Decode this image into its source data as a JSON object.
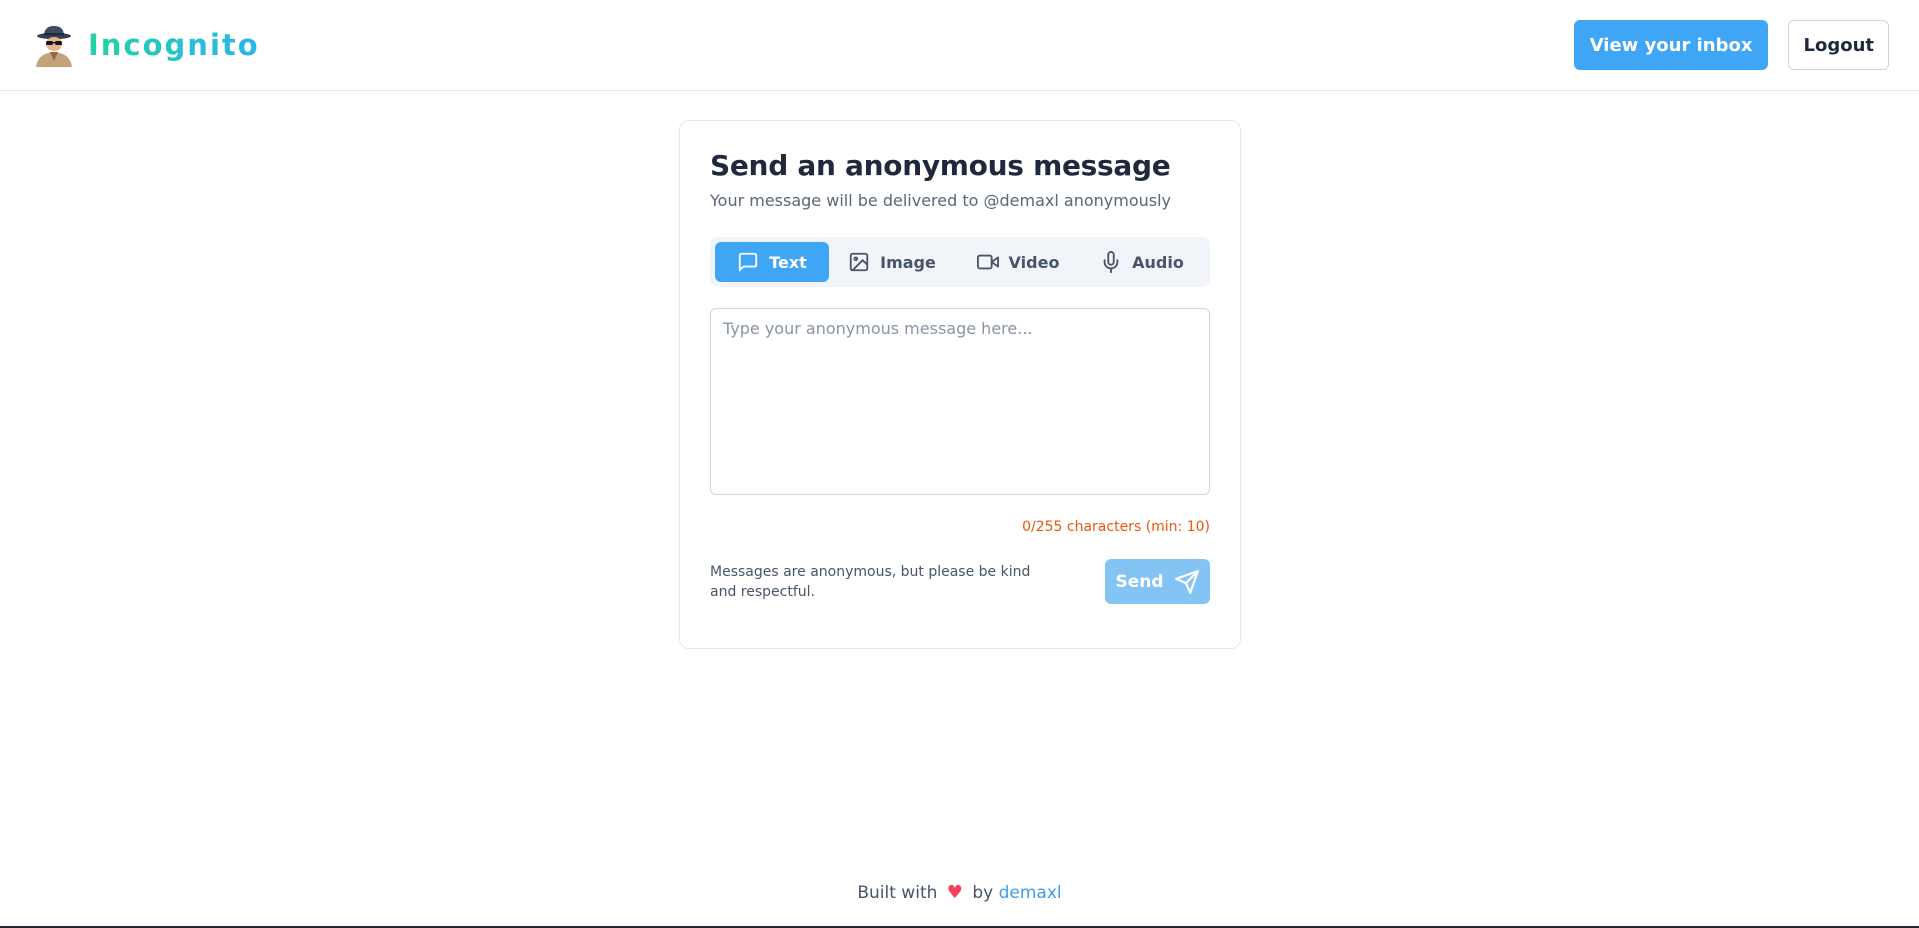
{
  "brand": {
    "name": "Incognito",
    "logo_icon": "spy-icon",
    "gradient": [
      "#22d3a4",
      "#2bb3f0"
    ]
  },
  "header": {
    "inbox_button": "View your inbox",
    "logout_button": "Logout"
  },
  "card": {
    "title": "Send an anonymous message",
    "subtitle": "Your message will be delivered to @demaxl anonymously",
    "tabs": [
      {
        "label": "Text",
        "icon": "message-square-icon",
        "active": true
      },
      {
        "label": "Image",
        "icon": "image-icon",
        "active": false
      },
      {
        "label": "Video",
        "icon": "video-icon",
        "active": false
      },
      {
        "label": "Audio",
        "icon": "mic-icon",
        "active": false
      }
    ],
    "message": {
      "value": "",
      "placeholder": "Type your anonymous message here..."
    },
    "counter": "0/255 characters (min: 10)",
    "note": "Messages are anonymous, but please be kind and respectful.",
    "send_button": "Send"
  },
  "footer": {
    "built_with": "Built with",
    "heart": "♥",
    "by": "by",
    "author": "demaxl"
  },
  "colors": {
    "accent": "#3ea6f5",
    "accent_disabled": "#83c4f5",
    "warning": "#ea580c",
    "heart": "#f43f5e",
    "link": "#3b9eea"
  }
}
